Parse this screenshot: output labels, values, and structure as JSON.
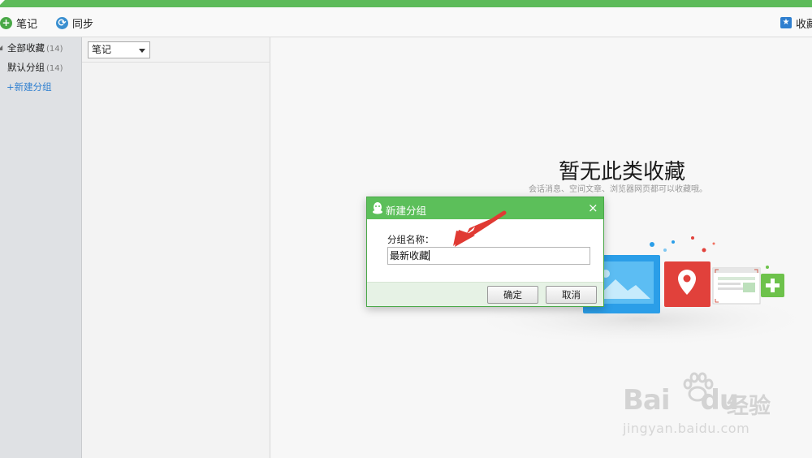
{
  "toolbar": {
    "note_label": "笔记",
    "sync_label": "同步",
    "favorites_label": "收藏"
  },
  "sidebar": {
    "items": [
      {
        "label": "全部收藏",
        "count": "(14)"
      },
      {
        "label": "默认分组",
        "count": "(14)"
      }
    ],
    "new_group_label": "+新建分组"
  },
  "filter": {
    "selected": "笔记"
  },
  "empty_state": {
    "title": "暂无此类收藏",
    "subtitle": "会话消息、空间文章、浏览器网页都可以收藏哦。"
  },
  "dialog": {
    "title": "新建分组",
    "close": "×",
    "field_label": "分组名称：",
    "field_value": "最新收藏",
    "ok_label": "确定",
    "cancel_label": "取消"
  },
  "watermark": {
    "brand_latin_1": "Bai",
    "brand_latin_2": "du",
    "brand_cn": "经验",
    "url": "jingyan.baidu.com"
  },
  "colors": {
    "titlebar": "#5dbb5a",
    "dialog_header": "#5cbf5a",
    "accent_blue": "#2e7fd0",
    "arrow": "#e03a33"
  }
}
